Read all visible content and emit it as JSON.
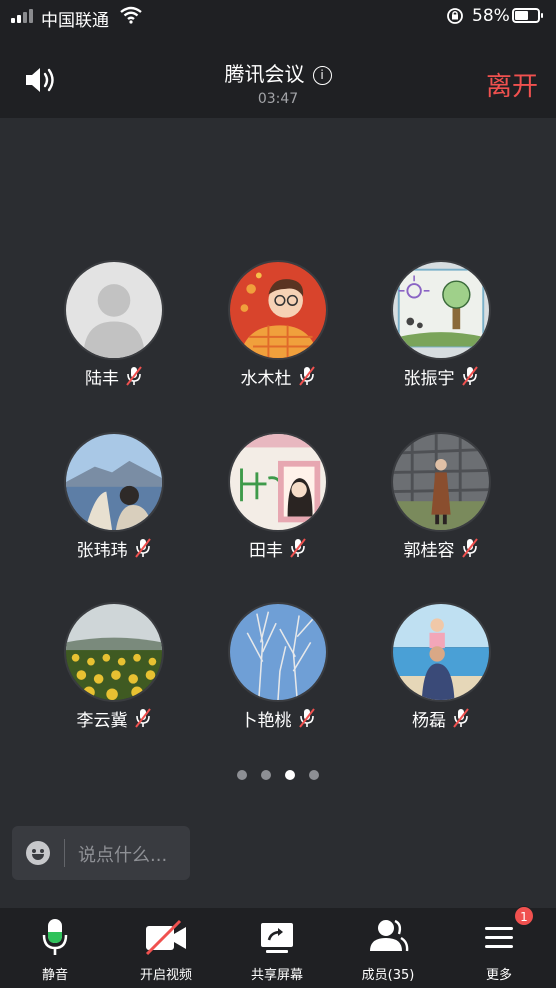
{
  "status_bar": {
    "carrier": "中国联通",
    "battery_percent": "58%",
    "battery_level": 0.58
  },
  "header": {
    "title": "腾讯会议",
    "info_icon": "i",
    "timer": "03:47",
    "leave_label": "离开"
  },
  "participants": [
    {
      "name": "陆丰",
      "avatar": "default-person-avatar",
      "muted": true
    },
    {
      "name": "水木杜",
      "avatar": "cartoon-glasses-avatar",
      "muted": true
    },
    {
      "name": "张振宇",
      "avatar": "child-drawing-avatar",
      "muted": true
    },
    {
      "name": "张玮玮",
      "avatar": "lake-mountain-photo-avatar",
      "muted": true
    },
    {
      "name": "田丰",
      "avatar": "anime-sketch-avatar",
      "muted": true
    },
    {
      "name": "郭桂容",
      "avatar": "woman-stone-wall-photo-avatar",
      "muted": true
    },
    {
      "name": "李云冀",
      "avatar": "sunflower-field-avatar",
      "muted": true
    },
    {
      "name": "卜艳桃",
      "avatar": "bare-tree-sky-avatar",
      "muted": true
    },
    {
      "name": "杨磊",
      "avatar": "beach-father-child-avatar",
      "muted": true
    }
  ],
  "pagination": {
    "total": 4,
    "active_index": 2
  },
  "chat": {
    "placeholder": "说点什么..."
  },
  "toolbar": {
    "mute_label": "静音",
    "video_label": "开启视频",
    "share_label": "共享屏幕",
    "members_label": "成员(35)",
    "more_label": "更多",
    "more_badge": "1"
  },
  "colors": {
    "background": "#2b2d31",
    "bar": "#1f2023",
    "leave": "#f0514f",
    "mic_active": "#2fc25b",
    "badge": "#f0514f"
  }
}
